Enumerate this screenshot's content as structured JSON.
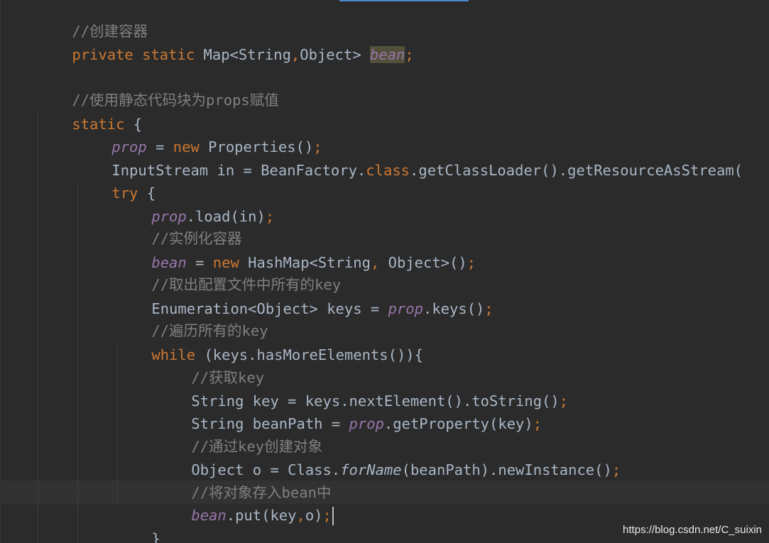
{
  "editor": {
    "theme_colors": {
      "background": "#2b2b2b",
      "default_text": "#a9b7c6",
      "keyword": "#cc7832",
      "comment": "#808080",
      "field": "#9876aa",
      "current_line": "#323232",
      "usage_highlight": "#52503a"
    },
    "lines": [
      {
        "text": "//创建容器"
      },
      {
        "t1": "private static ",
        "t2": "Map<String",
        "t3": ",",
        "t4": "Object> ",
        "t5": "bean",
        "t6": ";"
      },
      {
        "text": ""
      },
      {
        "text": "//使用静态代码块为props赋值"
      },
      {
        "t1": "static ",
        "t2": "{"
      },
      {
        "t1": "prop",
        "t2": " = ",
        "t3": "new ",
        "t4": "Properties()",
        "t5": ";"
      },
      {
        "t1": "InputStream in = BeanFactory.",
        "t2": "class",
        "t3": ".getClassLoader().getResourceAsStream("
      },
      {
        "t1": "try ",
        "t2": "{"
      },
      {
        "t1": "prop",
        "t2": ".load(in)",
        "t3": ";"
      },
      {
        "text": "//实例化容器"
      },
      {
        "t1": "bean",
        "t2": " = ",
        "t3": "new ",
        "t4": "HashMap<String",
        "t5": ", ",
        "t6": "Object>()",
        "t7": ";"
      },
      {
        "text": "//取出配置文件中所有的key"
      },
      {
        "t1": "Enumeration<Object> keys = ",
        "t2": "prop",
        "t3": ".keys()",
        "t4": ";"
      },
      {
        "text": "//遍历所有的key"
      },
      {
        "t1": "while ",
        "t2": "(keys.hasMoreElements()){"
      },
      {
        "text": "//获取key"
      },
      {
        "t1": "String key = keys.nextElement().toString()",
        "t2": ";"
      },
      {
        "t1": "String beanPath = ",
        "t2": "prop",
        "t3": ".getProperty(key)",
        "t4": ";"
      },
      {
        "text": "//通过key创建对象"
      },
      {
        "t1": "Object o = Class.",
        "t2": "forName",
        "t3": "(beanPath).newInstance()",
        "t4": ";"
      },
      {
        "text": "//将对象存入bean中"
      },
      {
        "t1": "bean",
        "t2": ".put(key",
        "t3": ",",
        "t4": "o)",
        "t5": ";"
      },
      {
        "text": "}"
      }
    ]
  },
  "watermark": "https://blog.csdn.net/C_suixin"
}
